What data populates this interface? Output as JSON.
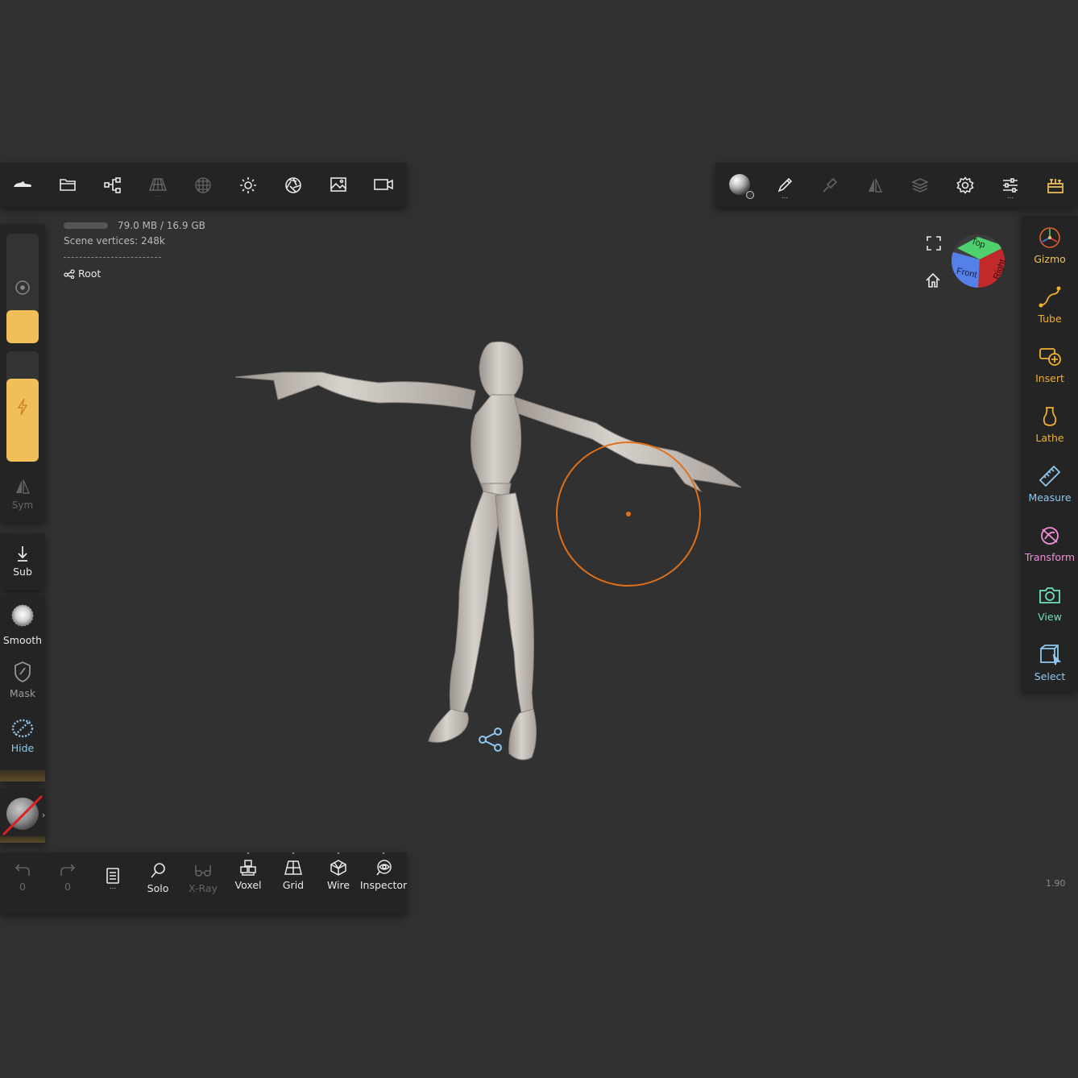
{
  "top_left_toolbar": {
    "items": [
      {
        "name": "project-icon"
      },
      {
        "name": "open-folder-icon"
      },
      {
        "name": "scene-tree-icon"
      },
      {
        "name": "topology-icon",
        "disabled": true
      },
      {
        "name": "material-sphere-icon",
        "disabled": true
      },
      {
        "name": "lighting-sun-icon"
      },
      {
        "name": "aperture-icon"
      },
      {
        "name": "image-icon"
      },
      {
        "name": "video-camera-icon"
      }
    ]
  },
  "top_right_toolbar": {
    "items": [
      {
        "name": "matcap-sphere-icon"
      },
      {
        "name": "brush-pen-icon"
      },
      {
        "name": "stroke-brush-icon"
      },
      {
        "name": "symmetry-icon"
      },
      {
        "name": "layers-icon"
      },
      {
        "name": "settings-gear-icon"
      },
      {
        "name": "sliders-icon"
      },
      {
        "name": "store-icon"
      }
    ]
  },
  "info": {
    "memory": "79.0 MB / 16.9 GB",
    "vertices_label": "Scene vertices",
    "vertices_value": "248k",
    "root_label": "Root"
  },
  "left_panel": {
    "size_slider_fraction": 0.3,
    "intensity_slider_fraction": 0.75,
    "sym_label": "Sym",
    "sub_label": "Sub",
    "smooth_label": "Smooth",
    "mask_label": "Mask",
    "hide_label": "Hide"
  },
  "right_panel": {
    "items": [
      {
        "label": "Gizmo",
        "color": "#f0c060",
        "icon": "gizmo-icon"
      },
      {
        "label": "Tube",
        "color": "#f0b030",
        "icon": "tube-icon"
      },
      {
        "label": "Insert",
        "color": "#f0b030",
        "icon": "insert-icon"
      },
      {
        "label": "Lathe",
        "color": "#f0b030",
        "icon": "lathe-icon"
      },
      {
        "label": "Measure",
        "color": "#8ec8f0",
        "icon": "measure-icon"
      },
      {
        "label": "Transform",
        "color": "#f090d8",
        "icon": "transform-icon"
      },
      {
        "label": "View",
        "color": "#6ee0c0",
        "icon": "view-camera-icon"
      },
      {
        "label": "Select",
        "color": "#8ec8f0",
        "icon": "select-icon"
      }
    ]
  },
  "bottom_toolbar": {
    "undo_count": "0",
    "redo_count": "0",
    "buttons": {
      "solo": "Solo",
      "xray": "X-Ray",
      "voxel": "Voxel",
      "grid": "Grid",
      "wire": "Wire",
      "inspector": "Inspector"
    }
  },
  "view_cube": {
    "top": "Top",
    "front": "Front",
    "right": "Right"
  },
  "version": "1.90",
  "colors": {
    "accent": "#f0bf5a",
    "panel": "#242424",
    "background": "#313131",
    "brush_cursor": "#e07018"
  }
}
